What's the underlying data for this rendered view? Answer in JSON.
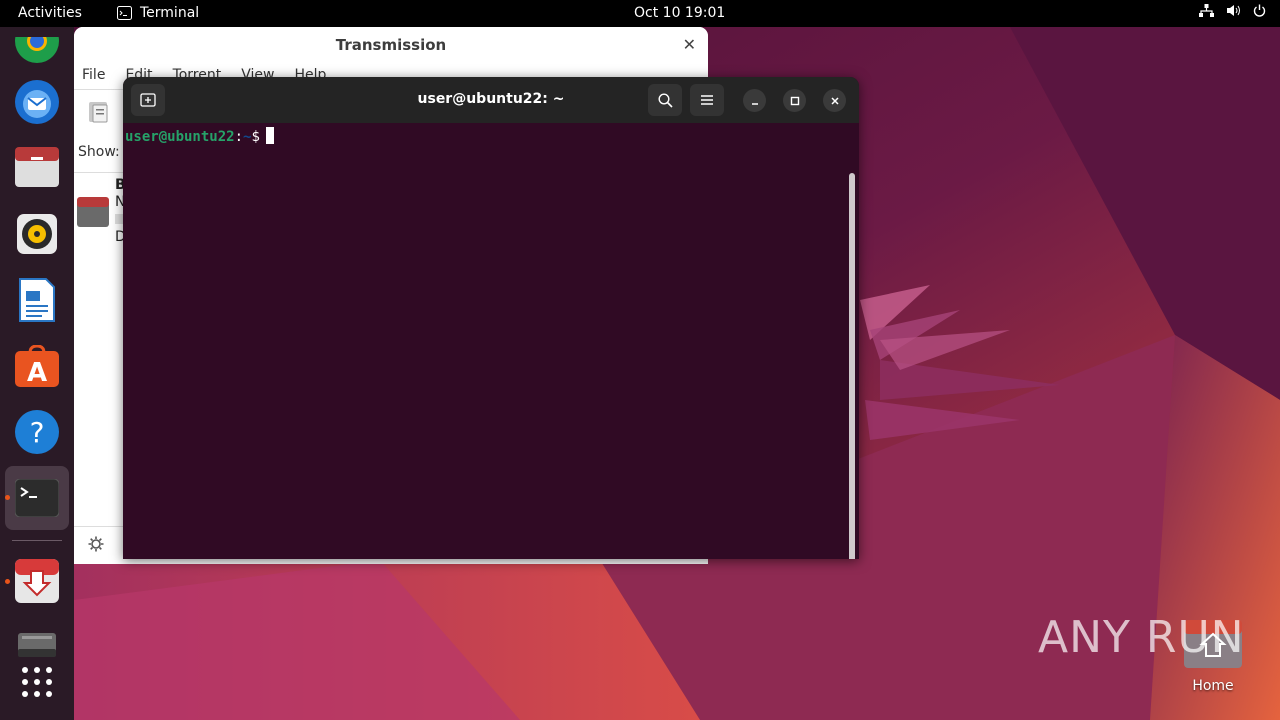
{
  "topbar": {
    "activities": "Activities",
    "app_name": "Terminal",
    "datetime": "Oct 10  19:01",
    "tray_icons": [
      "network-icon",
      "volume-icon",
      "power-icon"
    ]
  },
  "dock": {
    "items": [
      {
        "name": "chrome-icon",
        "running": false
      },
      {
        "name": "thunderbird-icon",
        "running": false
      },
      {
        "name": "files-icon",
        "running": false
      },
      {
        "name": "rhythmbox-icon",
        "running": false
      },
      {
        "name": "libreoffice-writer-icon",
        "running": false
      },
      {
        "name": "ubuntu-software-icon",
        "running": false
      },
      {
        "name": "help-icon",
        "running": false
      },
      {
        "name": "terminal-icon",
        "running": true
      },
      {
        "name": "transmission-icon",
        "running": true
      },
      {
        "name": "drive-icon",
        "running": false
      },
      {
        "name": "show-apps-icon",
        "running": false
      }
    ]
  },
  "transmission": {
    "title": "Transmission",
    "menu": [
      "File",
      "Edit",
      "Torrent",
      "View",
      "Help"
    ],
    "show_label": "Show:",
    "row_letters": [
      "B",
      "N",
      "D"
    ]
  },
  "terminal": {
    "title": "user@ubuntu22: ~",
    "prompt_user": "user@ubuntu22",
    "prompt_sep": ":",
    "prompt_path": "~",
    "prompt_symbol": "$"
  },
  "desktop": {
    "home_label": "Home",
    "watermark": "ANY RUN"
  },
  "colors": {
    "terminal_bg": "#300a24",
    "prompt_user": "#26a269",
    "prompt_path": "#12488b",
    "accent_dot": "#e9541a"
  }
}
